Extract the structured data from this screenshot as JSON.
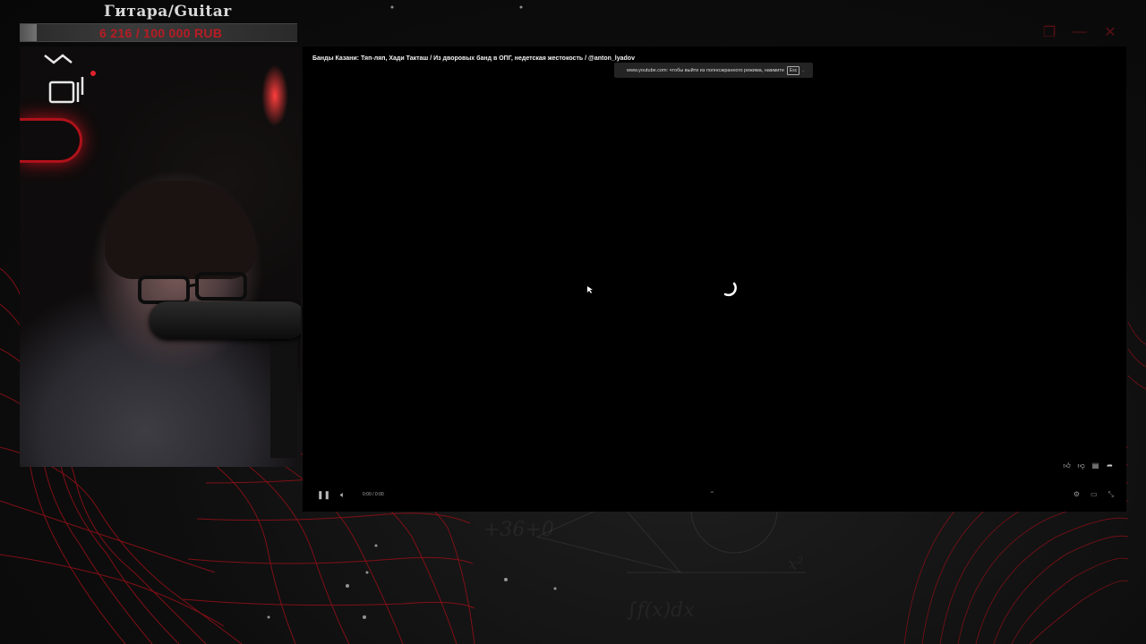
{
  "goal": {
    "title": "Гитара/Guitar",
    "amount_text": "6 216 / 100 000 RUB",
    "progress": 0.06216
  },
  "window_controls": {
    "restore_icon": "restore-icon",
    "minimize_icon": "minimize-icon",
    "close_icon": "close-icon"
  },
  "player": {
    "video_title": "Банды Казани: Тяп-ляп, Хади Такташ / Из дворовых банд в ОПГ, недетская жестокость / @anton_lyadov",
    "fullscreen_toast_text": "www.youtube.com: чтобы выйти из полноэкранного режима, нажмите",
    "fullscreen_toast_key": "Esc",
    "fullscreen_toast_after": ".",
    "time_text": "0:00 / 0:00"
  },
  "colors": {
    "accent_red": "#b71c24",
    "overlay_dark": "#0b0b0b",
    "player_bg": "#000000"
  }
}
